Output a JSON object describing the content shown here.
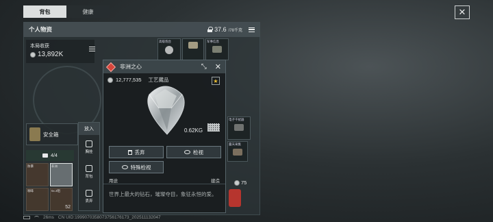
{
  "tabs": [
    {
      "label": "背包",
      "active": true
    },
    {
      "label": "健康",
      "active": false
    }
  ],
  "inventory": {
    "title": "个人物资",
    "weight": "37.6",
    "weight_max": "/78千克"
  },
  "earnings": {
    "label": "本局收获",
    "value": "13,892K"
  },
  "item_modal": {
    "name": "非洲之心",
    "value": "12,777,535",
    "category": "工艺藏品",
    "weight": "0.62KG",
    "buttons": {
      "discard": "丢弃",
      "inspect": "检视",
      "special_inspect": "特殊检视"
    },
    "use_label": "用途",
    "build_label": "建造",
    "description": "世界上最大的钻石，璀璨夺目，象征永恒的爱。"
  },
  "safe_box": {
    "label": "安全箱"
  },
  "capacity": {
    "value": "4/4"
  },
  "context_menu": {
    "title": "放入",
    "items": [
      "胸挂",
      "背包",
      "丢弃"
    ]
  },
  "mini_items": [
    {
      "label": "防暴"
    },
    {
      "label": "非洲"
    },
    {
      "label": "咖啡"
    },
    {
      "label": "5x.3阻",
      "count": "52"
    }
  ],
  "top_items": [
    "高级炮台",
    "",
    "军事信息"
  ],
  "right_items": [
    "电子干扰器",
    "露天采集"
  ],
  "right_count": "75",
  "status": {
    "ping": "26ms",
    "uid": "CN UID:1999070358073756176173_202511132047"
  }
}
